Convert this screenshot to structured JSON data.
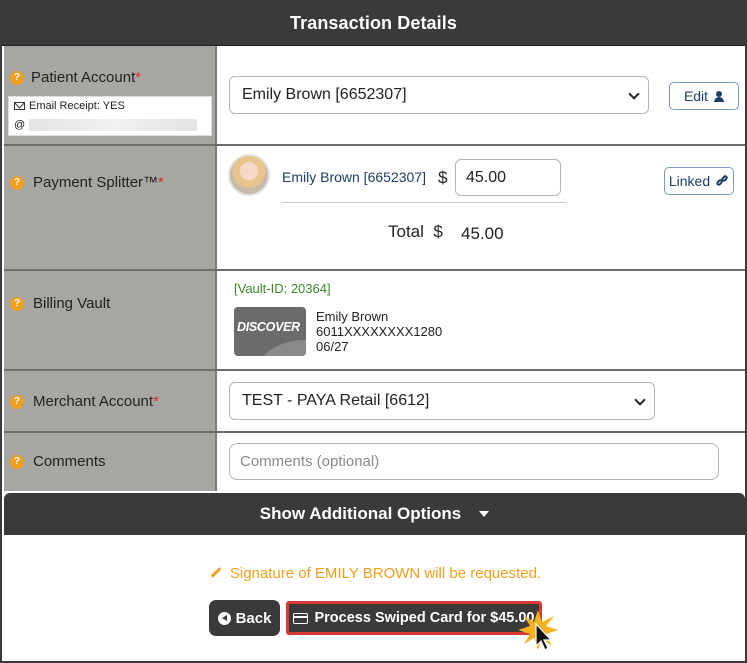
{
  "header": {
    "title": "Transaction Details"
  },
  "patient_account": {
    "label": "Patient Account",
    "required_mark": "*",
    "email_receipt": "Email Receipt: YES",
    "email_prefix": "@",
    "selected": "Emily Brown [6652307]",
    "edit_label": "Edit"
  },
  "payment_splitter": {
    "label": "Payment Splitter™",
    "required_mark": "*",
    "patient_name": "Emily Brown [6652307]",
    "currency": "$",
    "amount": "45.00",
    "linked_label": "Linked",
    "total_label": "Total",
    "total_currency": "$",
    "total_value": "45.00"
  },
  "billing_vault": {
    "label": "Billing Vault",
    "vault_id": "[Vault-ID: 20364]",
    "card_brand": "DISCOVER",
    "card_holder": "Emily Brown",
    "card_number": "6011XXXXXXXX1280",
    "card_expiry": "06/27"
  },
  "merchant_account": {
    "label": "Merchant Account",
    "required_mark": "*",
    "selected": "TEST - PAYA Retail [6612]"
  },
  "comments": {
    "label": "Comments",
    "placeholder": "Comments (optional)"
  },
  "additional_options": {
    "label": "Show Additional Options"
  },
  "signature_note": "Signature of EMILY BROWN will be requested.",
  "actions": {
    "back_label": "Back",
    "process_label": "Process Swiped Card for $45.00"
  },
  "colors": {
    "dark": "#3a3a3a",
    "label_bg": "#a8a6a3",
    "accent_orange": "#f0a020",
    "required_red": "#d9302c",
    "vault_green": "#3b8a2a",
    "link_blue": "#1e3f66",
    "highlight_red": "#d93a36"
  },
  "icons": [
    "help-icon",
    "envelope-icon",
    "user-icon",
    "link-icon",
    "pencil-icon",
    "back-arrow-icon",
    "credit-card-icon",
    "cursor-click-icon"
  ]
}
